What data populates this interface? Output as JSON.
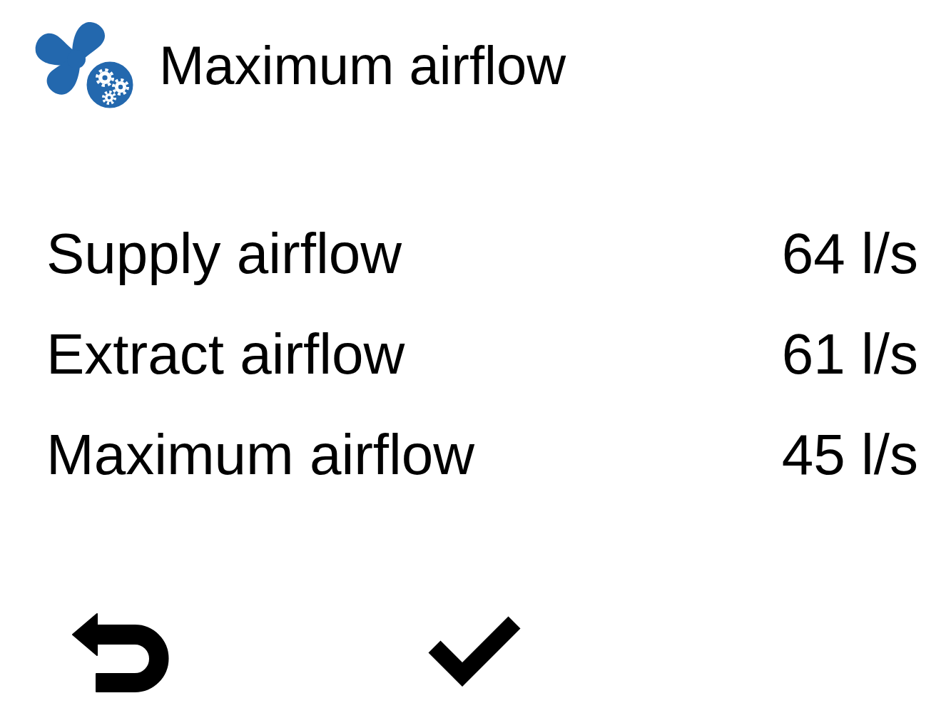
{
  "header": {
    "title": "Maximum airflow"
  },
  "rows": [
    {
      "label": "Supply airflow",
      "value": "64 l/s"
    },
    {
      "label": "Extract airflow",
      "value": "61 l/s"
    },
    {
      "label": "Maximum airflow",
      "value": "45 l/s"
    }
  ],
  "footer": {
    "buttons": [
      {
        "kind": "back"
      },
      {
        "kind": "confirm"
      }
    ]
  }
}
